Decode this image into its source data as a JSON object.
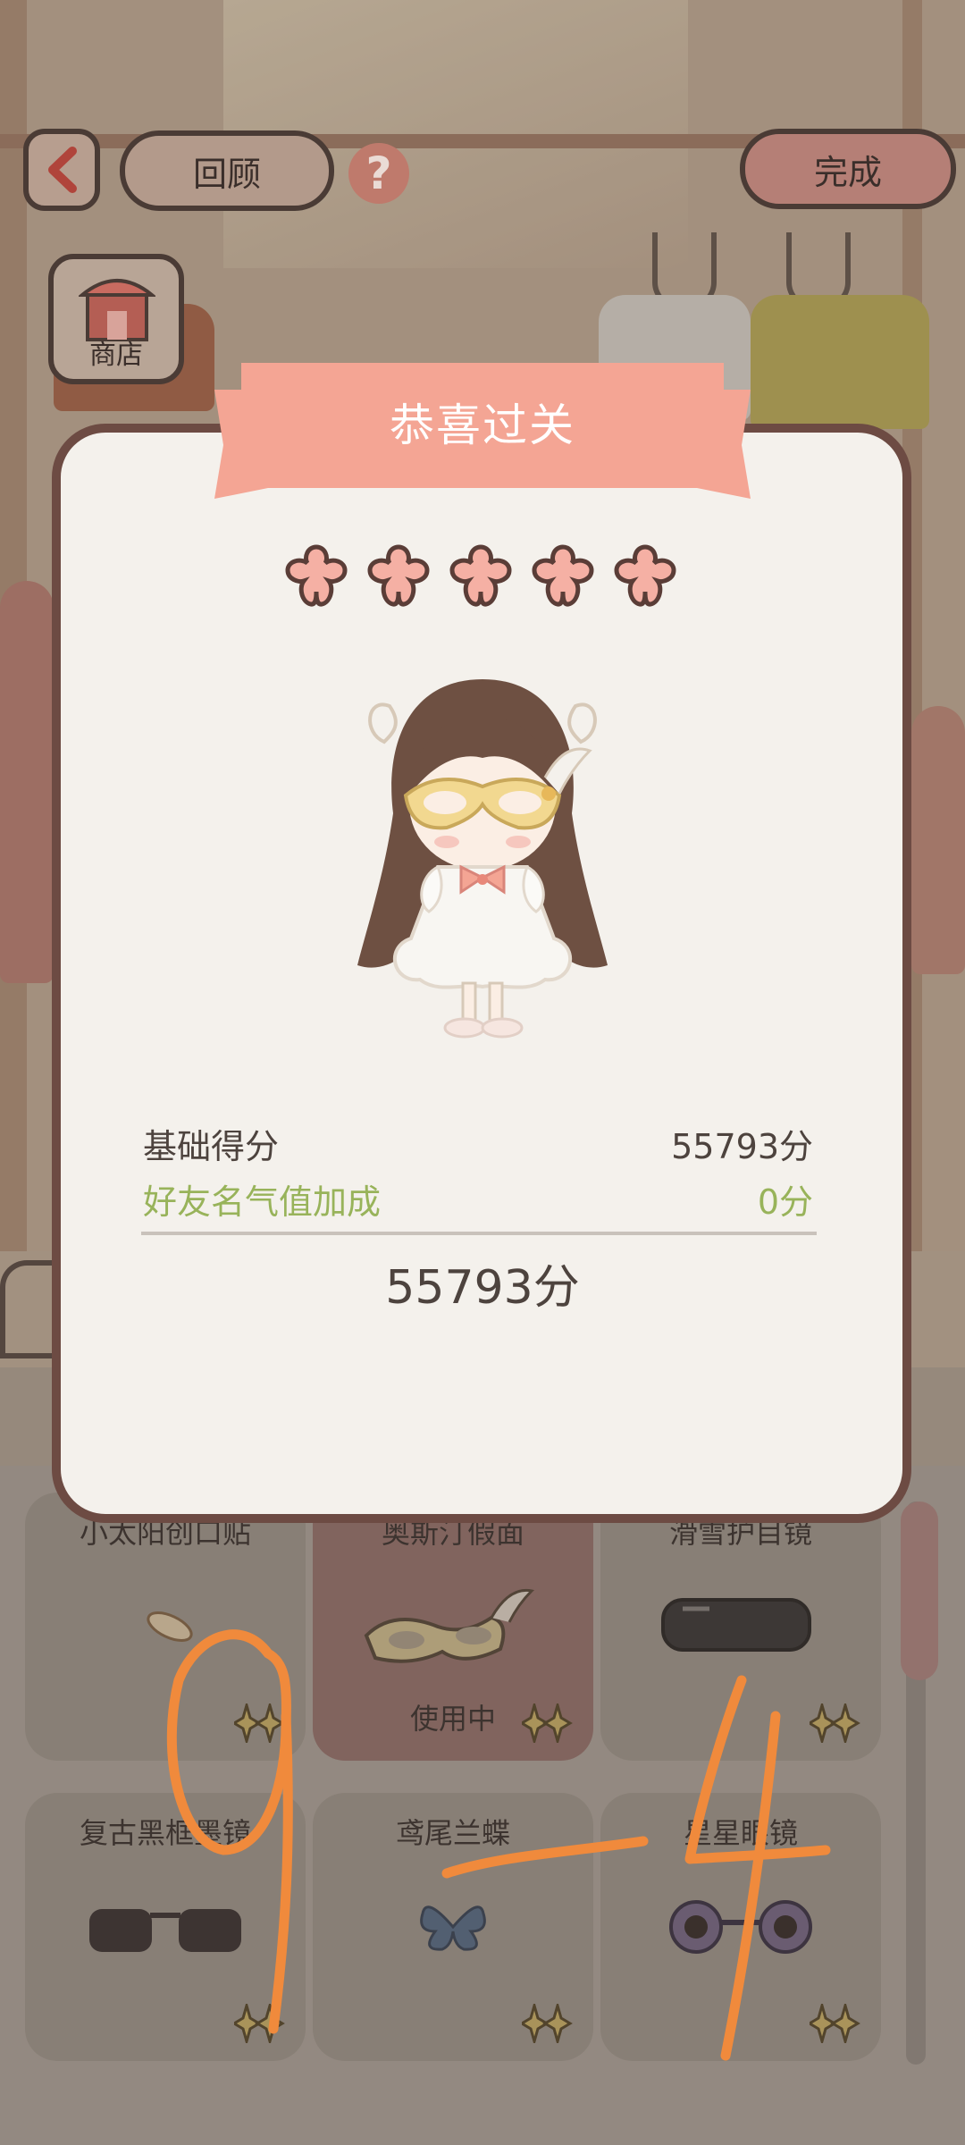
{
  "header": {
    "back_label": "",
    "review_label": "回顾",
    "help_label": "?",
    "done_label": "完成",
    "shop_label": "商店"
  },
  "dialog": {
    "title": "恭喜过关",
    "stars_filled": 5,
    "stars_total": 5,
    "score_base_label": "基础得分",
    "score_base_value": "55793分",
    "score_bonus_label": "好友名气值加成",
    "score_bonus_value": "0分",
    "score_total": "55793分"
  },
  "items": [
    {
      "name": "小太阳创口贴",
      "status": ""
    },
    {
      "name": "奥斯汀假面",
      "status": "使用中"
    },
    {
      "name": "滑雪护目镜",
      "status": ""
    },
    {
      "name": "复古黑框墨镜",
      "status": ""
    },
    {
      "name": "鸢尾兰蝶",
      "status": ""
    },
    {
      "name": "星星眼镜",
      "status": ""
    }
  ],
  "annotation_text": "9-4",
  "colors": {
    "ribbon": "#f4a594",
    "star": "#f5b0a4",
    "accent_green": "#98b35a",
    "annotation": "#f08a3c",
    "dialog_border": "#6d4b43"
  }
}
